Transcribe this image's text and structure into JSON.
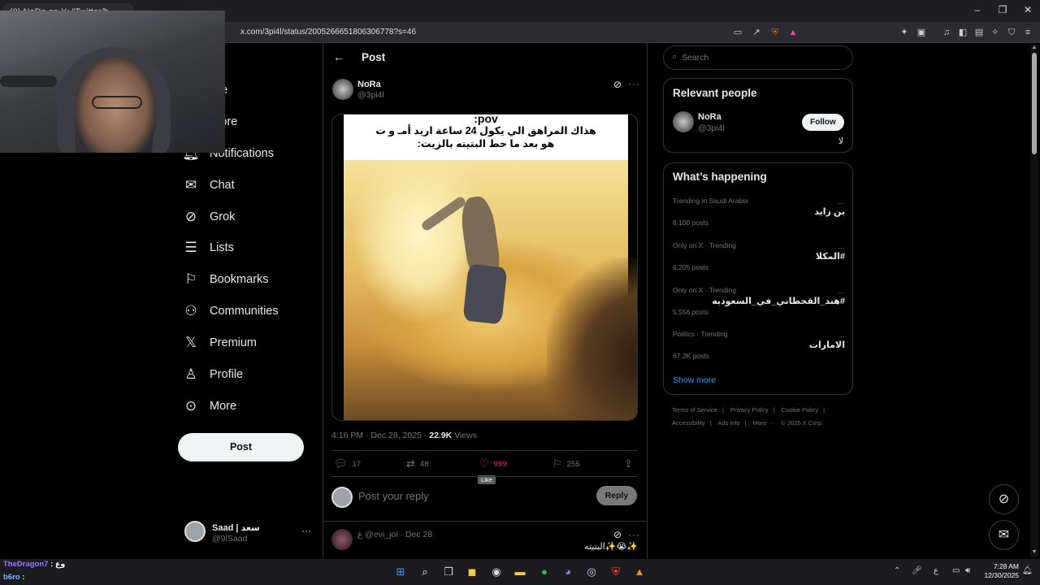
{
  "browser": {
    "tab_title": "(9) NoRa on X: \"Twitter/b...",
    "url": "x.com/3pi4l/status/2005266651806306778?s=46",
    "window_controls": [
      "–",
      "❐",
      "✕"
    ]
  },
  "nav": {
    "items": [
      {
        "label": "Home",
        "icon": "home-icon",
        "visible_label": "me"
      },
      {
        "label": "Explore",
        "icon": "search-icon",
        "visible_label": "plore"
      },
      {
        "label": "Notifications",
        "icon": "bell-icon"
      },
      {
        "label": "Chat",
        "icon": "mail-icon"
      },
      {
        "label": "Grok",
        "icon": "grok-icon"
      },
      {
        "label": "Lists",
        "icon": "list-icon"
      },
      {
        "label": "Bookmarks",
        "icon": "bookmark-icon"
      },
      {
        "label": "Communities",
        "icon": "people-icon"
      },
      {
        "label": "Premium",
        "icon": "x-logo-icon"
      },
      {
        "label": "Profile",
        "icon": "person-icon"
      },
      {
        "label": "More",
        "icon": "more-circle-icon"
      }
    ],
    "post_button": "Post",
    "account": {
      "name": "Saad | سعد",
      "handle": "@9lSaad"
    }
  },
  "header": {
    "title": "Post"
  },
  "post": {
    "author_name": "NoRa",
    "author_handle": "@3pi4l",
    "meme_pov": "pov:",
    "meme_line1": "هذاك المراهق الي يكول 24 ساعة اريد أمـ و ت",
    "meme_line2": "هو بعد ما حط البتيته بالزيت:",
    "time": "4:16 PM · Dec 28, 2025 ·",
    "views_count": "22.9K",
    "views_label": "Views",
    "replies": "17",
    "reposts": "48",
    "likes": "999",
    "bookmarks": "255",
    "like_tooltip": "Like"
  },
  "reply": {
    "placeholder": "Post your reply",
    "button": "Reply"
  },
  "comment": {
    "line": "غ @evi_joi · Dec 28",
    "text": "✨😭✨البتيته"
  },
  "search": {
    "placeholder": "Search"
  },
  "relevant_people": {
    "title": "Relevant people",
    "name": "NoRa",
    "handle": "@3pi4l",
    "follow": "Follow",
    "bio": "لا"
  },
  "happening": {
    "title": "What’s happening",
    "trends": [
      {
        "context": "Trending in Saudi Arabia",
        "name": "بن زايد",
        "posts": "8,100 posts"
      },
      {
        "context": "Only on X · Trending",
        "name": "#المكلا",
        "posts": "6,205 posts"
      },
      {
        "context": "Only on X · Trending",
        "name": "#هند_القحطاني_في_السعوديه",
        "posts": "5,556 posts"
      },
      {
        "context": "Politics · Trending",
        "name": "الامارات",
        "posts": "67.2K posts"
      }
    ],
    "show_more": "Show more"
  },
  "footer": {
    "row1": [
      "Terms of Service",
      "|",
      "Privacy Policy",
      "|",
      "Cookie Policy",
      "|"
    ],
    "row2": [
      "Accessibility",
      "|",
      "Ads info",
      "|",
      "More ···",
      "© 2025 X Corp."
    ]
  },
  "stream_chat": [
    {
      "user": "TheDragon7",
      "msg": " : وع"
    },
    {
      "user": "b6ro",
      "msg": " : "
    }
  ],
  "taskbar": {
    "time": "7:28 AM",
    "date": "12/30/2025",
    "lang": "ع"
  },
  "colors": {
    "accent": "#1d9bf0",
    "like": "#f91880",
    "bg": "#000000"
  }
}
